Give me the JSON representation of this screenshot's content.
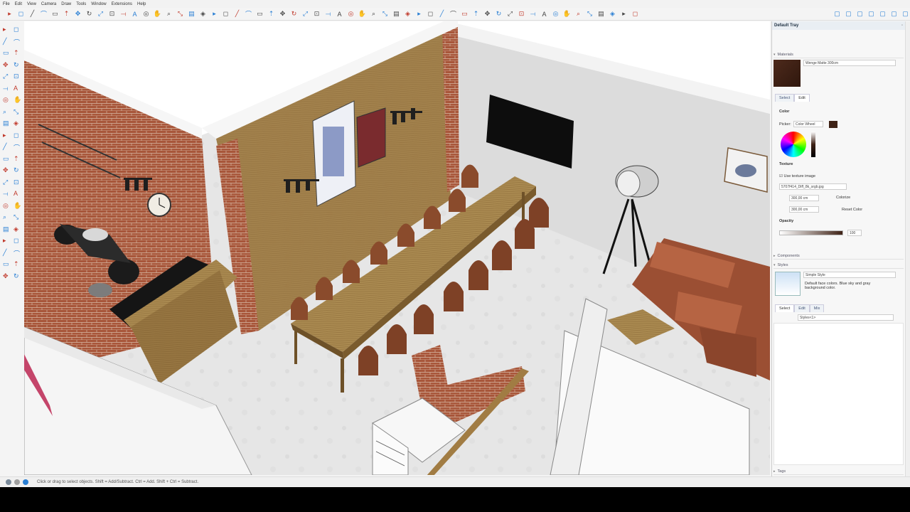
{
  "menu": [
    "File",
    "Edit",
    "View",
    "Camera",
    "Draw",
    "Tools",
    "Window",
    "Extensions",
    "Help"
  ],
  "tray": {
    "title": "Default Tray",
    "materials": {
      "header": "Materials",
      "name": "Wenge Matte 300cm",
      "tabs": [
        "Select",
        "Edit"
      ],
      "color_label": "Color",
      "picker_label": "Picker:",
      "picker_value": "Color Wheel",
      "texture_label": "Texture",
      "use_texture_label": "Use texture image",
      "texture_file": "5707f414_Diff_8k_srgb.jpg",
      "width_value": "300,00 cm",
      "height_value": "300,00 cm",
      "colorize_label": "Colorize",
      "reset_color_label": "Reset Color",
      "opacity_label": "Opacity",
      "opacity_value": "100",
      "swatch_color": "#3f2216"
    },
    "components": {
      "header": "Components"
    },
    "styles": {
      "header": "Styles",
      "name": "Simple Style",
      "description": "Default face colors. Blue sky and gray background color.",
      "tabs": [
        "Select",
        "Edit",
        "Mix"
      ],
      "dropdown": "Styles<1>"
    },
    "tags": {
      "header": "Tags"
    }
  },
  "status": {
    "hint": "Click or drag to select objects. Shift = Add/Subtract. Ctrl = Add. Shift + Ctrl = Subtract."
  },
  "icons": {
    "toolbar": [
      "select-icon",
      "eraser-icon",
      "line-icon",
      "arc-icon",
      "rectangle-icon",
      "push-pull-icon",
      "move-icon",
      "rotate-icon",
      "scale-icon",
      "offset-icon",
      "tape-icon",
      "text-icon",
      "orbit-icon",
      "pan-icon",
      "zoom-icon",
      "zoom-extents-icon",
      "section-icon",
      "styles-icon"
    ]
  },
  "colors": {
    "accent": "#2a7fd4",
    "brick": "#a6553a",
    "wood": "#a7844a",
    "leather": "#9b4f33",
    "wall": "#d9d9d9"
  }
}
